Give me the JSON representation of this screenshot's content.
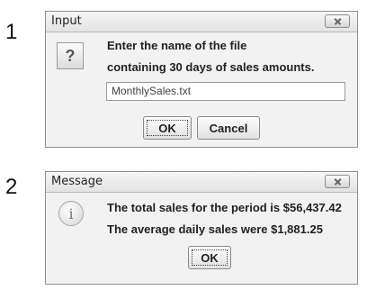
{
  "steps": [
    "1",
    "2"
  ],
  "input_dialog": {
    "title": "Input",
    "icon": "question-icon",
    "message_line1": "Enter the name of the file",
    "message_line2": "containing 30 days of sales amounts.",
    "field_value": "MonthlySales.txt",
    "ok_label": "OK",
    "cancel_label": "Cancel"
  },
  "message_dialog": {
    "title": "Message",
    "icon": "info-icon",
    "message_line1": "The total sales for the period is $56,437.42",
    "message_line2": "The average daily sales were $1,881.25",
    "ok_label": "OK"
  }
}
